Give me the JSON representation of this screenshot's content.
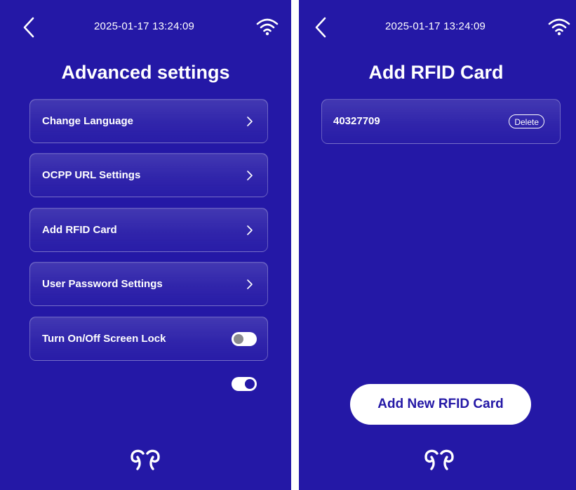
{
  "left_screen": {
    "datetime": "2025-01-17 13:24:09",
    "title": "Advanced settings",
    "menu": [
      {
        "label": "Change Language"
      },
      {
        "label": "OCPP URL Settings"
      },
      {
        "label": "Add RFID Card"
      },
      {
        "label": "User Password Settings"
      },
      {
        "label": "Turn On/Off Screen Lock"
      }
    ],
    "screen_lock_toggle": "off",
    "extra_toggle": "on",
    "icons": {
      "back": "chevron-left-icon",
      "wifi": "wifi-icon",
      "logo": "brand-logo"
    }
  },
  "right_screen": {
    "datetime": "2025-01-17 13:24:09",
    "title": "Add RFID Card",
    "cards": [
      {
        "number": "40327709",
        "delete_label": "Delete"
      }
    ],
    "add_button_label": "Add New RFID Card",
    "icons": {
      "back": "chevron-left-icon",
      "wifi": "wifi-icon",
      "logo": "brand-logo"
    }
  },
  "colors": {
    "background": "#2418a6",
    "text": "#ffffff",
    "button_fill": "#ffffff",
    "button_text": "#2418a6",
    "toggle_off_knob": "#8a8a8e"
  }
}
